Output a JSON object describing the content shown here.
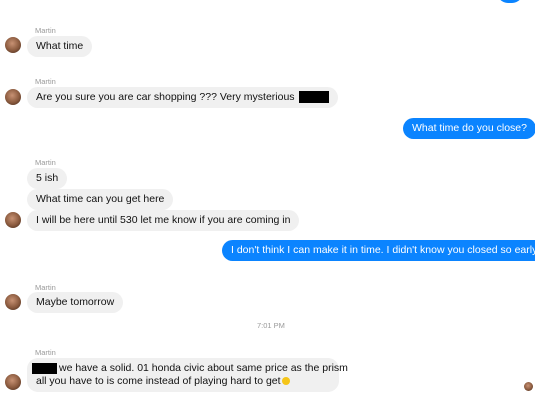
{
  "conversation": {
    "messages": [
      {
        "sender": "Martin",
        "text": "What time"
      },
      {
        "sender": "Martin",
        "text": "Are you sure you are car shopping ??? Very mysterious"
      },
      {
        "text": "What time do you close?"
      },
      {
        "sender": "Martin",
        "text": "5 ish"
      },
      {
        "text": "What time can you get here"
      },
      {
        "text": "I will be here until 530 let me know if you are coming in"
      },
      {
        "text": "I don't think I can make it in time. I didn't know you closed so early."
      },
      {
        "sender": "Martin",
        "text": "Maybe tomorrow"
      },
      {
        "timestamp": "7:01 PM"
      },
      {
        "sender": "Martin",
        "line1": "we have a solid. 01 honda civic about same price as the prism",
        "line2": "all you have to is come instead of playing hard to get"
      }
    ]
  },
  "colors": {
    "outgoing_bubble": "#0b84ff",
    "incoming_bubble": "#f0f0f0",
    "meta_text": "#9a9a9a"
  },
  "icons": {
    "avatar": "profile-photo",
    "emoji": "smiling-face-emoji"
  }
}
